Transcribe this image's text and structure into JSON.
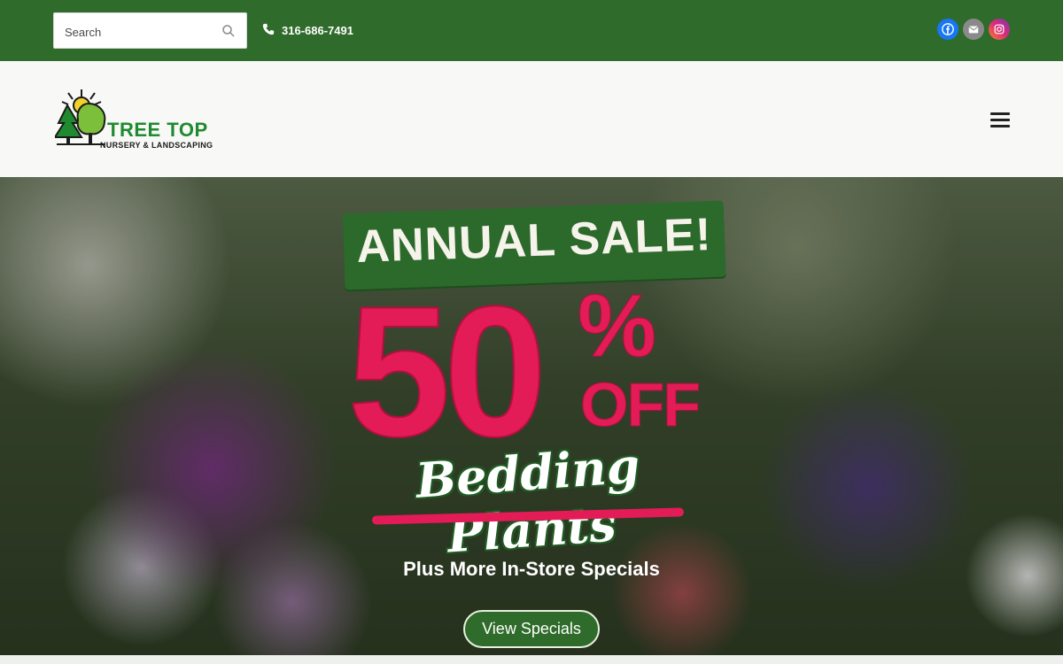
{
  "topbar": {
    "search_placeholder": "Search",
    "phone": "316-686-7491",
    "socials": [
      {
        "name": "facebook-icon",
        "color": "#1877f2"
      },
      {
        "name": "email-icon",
        "color": "#8a8a8a"
      },
      {
        "name": "instagram-icon",
        "color": "#e1306c"
      }
    ]
  },
  "header": {
    "logo_title": "TREE TOP",
    "logo_subtitle": "NURSERY & LANDSCAPING"
  },
  "hero": {
    "headline": "ANNUAL SALE!",
    "discount_number": "50",
    "percent": "%",
    "off": "OFF",
    "product": "Bedding Plants",
    "subtext": "Plus More In-Store Specials",
    "cta_label": "View Specials"
  },
  "colors": {
    "topbar_green": "#2f6b2a",
    "accent_pink": "#e31b57",
    "logo_green": "#1f8a2f"
  }
}
